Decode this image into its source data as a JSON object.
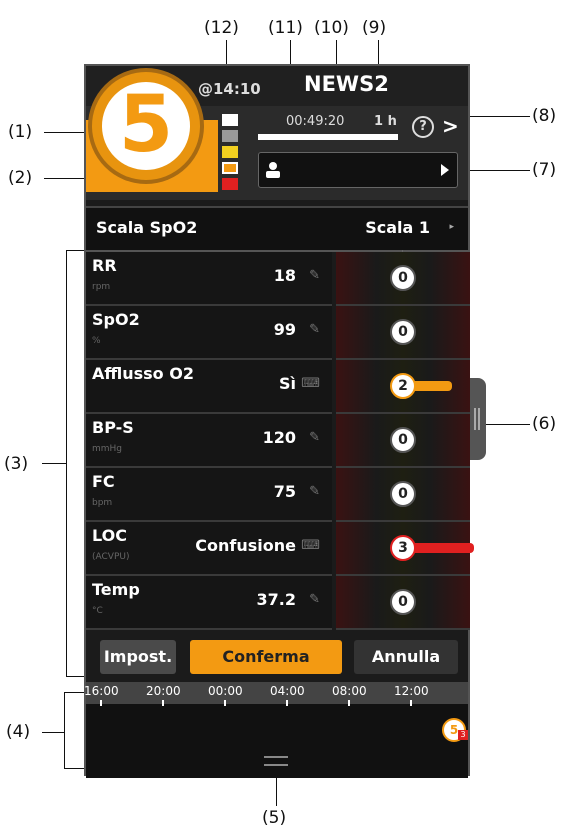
{
  "callouts": [
    "(1)",
    "(2)",
    "(3)",
    "(4)",
    "(5)",
    "(6)",
    "(7)",
    "(8)",
    "(9)",
    "(10)",
    "(11)",
    "(12)"
  ],
  "header": {
    "title": "NEWS2",
    "timestamp": "@14:10",
    "total_score": "5",
    "timer": "00:49:20",
    "interval": "1 h",
    "help_glyph": "?",
    "chevron": ">"
  },
  "scale": {
    "label": "Scala SpO2",
    "value": "Scala 1",
    "arrow": "▸"
  },
  "params": [
    {
      "name": "RR",
      "unit": "rpm",
      "value": "18",
      "score": "0",
      "edit": "pencil-icon"
    },
    {
      "name": "SpO2",
      "unit": "%",
      "value": "99",
      "score": "0",
      "edit": "pencil-icon"
    },
    {
      "name": "Afflusso O2",
      "unit": "",
      "value": "Sì",
      "score": "2",
      "edit": "keyboard-icon"
    },
    {
      "name": "BP-S",
      "unit": "mmHg",
      "value": "120",
      "score": "0",
      "edit": "pencil-icon"
    },
    {
      "name": "FC",
      "unit": "bpm",
      "value": "75",
      "score": "0",
      "edit": "pencil-icon"
    },
    {
      "name": "LOC",
      "unit": "(ACVPU)",
      "value": "Confusione",
      "score": "3",
      "edit": "keyboard-icon"
    },
    {
      "name": "Temp",
      "unit": "°C",
      "value": "37.2",
      "score": "0",
      "edit": "pencil-icon"
    }
  ],
  "buttons": {
    "setup": "Impost.",
    "confirm": "Conferma",
    "cancel": "Annulla"
  },
  "timeline": {
    "ticks": [
      "16:00",
      "20:00",
      "00:00",
      "04:00",
      "08:00",
      "12:00"
    ],
    "marker_score": "5",
    "marker_badge": "3"
  },
  "colors": {
    "orange": "#f39a12",
    "red": "#e02020",
    "yellow": "#f2d020"
  }
}
